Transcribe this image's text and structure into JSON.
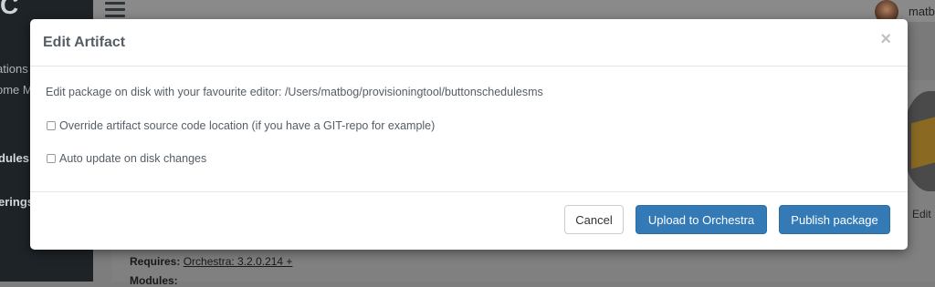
{
  "background": {
    "logo": "C",
    "nav_items": [
      "ations",
      "ome M",
      "dules",
      "erings"
    ],
    "user_name": "matb",
    "side_label": "Edit",
    "requires_label": "Requires:",
    "requires_link": "Orchestra: 3.2.0.214 +",
    "modules_label": "Modules:"
  },
  "modal": {
    "title": "Edit Artifact",
    "close_glyph": "×",
    "editor_line": "Edit package on disk with your favourite editor: /Users/matbog/provisioningtool/buttonschedulesms",
    "checkboxes": [
      {
        "label": "Override artifact source code location (if you have a GIT-repo for example)",
        "checked": false
      },
      {
        "label": "Auto update on disk changes",
        "checked": false
      }
    ],
    "buttons": {
      "cancel": "Cancel",
      "upload": "Upload to Orchestra",
      "publish": "Publish package"
    }
  },
  "colors": {
    "primary": "#337ab7",
    "sidebar": "#1d2327",
    "overlay": "#7d7d7d"
  }
}
